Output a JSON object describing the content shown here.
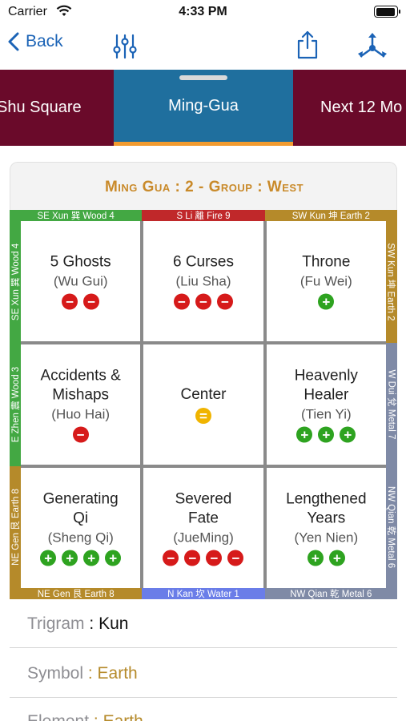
{
  "status_bar": {
    "carrier": "Carrier",
    "time": "4:33 PM",
    "battery_level": 0.95
  },
  "navbar": {
    "back_label": "Back"
  },
  "tabs": [
    {
      "label": "Shu Square",
      "active": false
    },
    {
      "label": "Ming-Gua",
      "active": true
    },
    {
      "label": "Next 12 Mo",
      "active": false
    }
  ],
  "card": {
    "title": "Ming Gua : 2 - Group : West"
  },
  "edges": {
    "top": [
      {
        "label": "SE Xun 巽 Wood 4",
        "color": "#43a843"
      },
      {
        "label": "S Li 離 Fire 9",
        "color": "#c0282a"
      },
      {
        "label": "SW Kun 坤 Earth 2",
        "color": "#b58a2a"
      }
    ],
    "bottom": [
      {
        "label": "NE Gen 艮 Earth 8",
        "color": "#b58a2a"
      },
      {
        "label": "N Kan 坎 Water 1",
        "color": "#6a7de8"
      },
      {
        "label": "NW Qian 乾 Metal 6",
        "color": "#7f8aa6"
      }
    ],
    "left": [
      {
        "label": "SE Xun 巽 Wood 4",
        "color": "#43a843"
      },
      {
        "label": "E Zhen 震 Wood 3",
        "color": "#43a843"
      },
      {
        "label": "NE Gen 艮 Earth 8",
        "color": "#b58a2a"
      }
    ],
    "right": [
      {
        "label": "SW Kun 坤 Earth 2",
        "color": "#b58a2a"
      },
      {
        "label": "W Dui 兌 Metal 7",
        "color": "#7f8aa6"
      },
      {
        "label": "NW Qian 乾 Metal 6",
        "color": "#7f8aa6"
      }
    ]
  },
  "grid": [
    {
      "name": "5 Ghosts",
      "sub": "(Wu Gui)",
      "marks": [
        "minus",
        "minus"
      ]
    },
    {
      "name": "6 Curses",
      "sub": "(Liu Sha)",
      "marks": [
        "minus",
        "minus",
        "minus"
      ]
    },
    {
      "name": "Throne",
      "sub": "(Fu Wei)",
      "marks": [
        "plus"
      ]
    },
    {
      "name": "Accidents & Mishaps",
      "sub": "(Huo Hai)",
      "marks": [
        "minus"
      ]
    },
    {
      "name": "Center",
      "sub": "",
      "marks": [
        "eq"
      ]
    },
    {
      "name": "Heavenly Healer",
      "sub": "(Tien Yi)",
      "marks": [
        "plus",
        "plus",
        "plus"
      ]
    },
    {
      "name": "Generating Qi",
      "sub": "(Sheng Qi)",
      "marks": [
        "plus",
        "plus",
        "plus",
        "plus"
      ]
    },
    {
      "name": "Severed Fate",
      "sub": "(JueMing)",
      "marks": [
        "minus",
        "minus",
        "minus",
        "minus"
      ]
    },
    {
      "name": "Lengthened Years",
      "sub": "(Yen Nien)",
      "marks": [
        "plus",
        "plus"
      ]
    }
  ],
  "mark_glyphs": {
    "minus": "−",
    "plus": "+",
    "eq": "="
  },
  "details": [
    {
      "label": "Trigram",
      "sep": " : ",
      "value": "Kun"
    },
    {
      "label": "Symbol",
      "sep": " : ",
      "value": "Earth"
    },
    {
      "label": "Element",
      "sep": " : ",
      "value": "Earth"
    }
  ],
  "icons": [
    "wifi-icon",
    "chevron-left-icon",
    "sliders-icon",
    "share-icon",
    "network-icon"
  ]
}
